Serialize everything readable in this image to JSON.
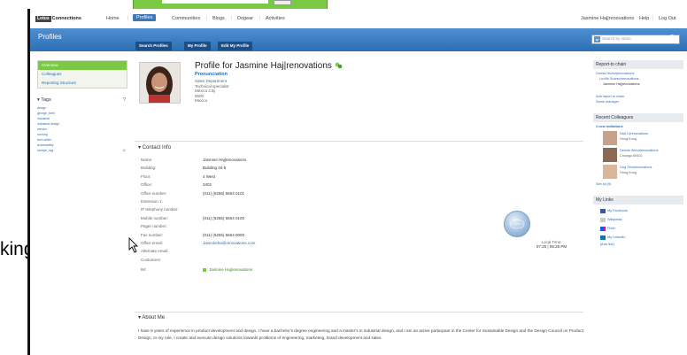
{
  "topnav": {
    "logo_left": "Lotus",
    "logo_right": "Connections",
    "items": [
      "Home",
      "Profiles",
      "Communities",
      "Blogs",
      "Dogear",
      "Activities"
    ],
    "active_index": 1,
    "user": "Jasmine Haj|renovations",
    "help": "Help",
    "logout": "Log Out"
  },
  "header": {
    "title": "Profiles",
    "subtabs": [
      "Search Profiles",
      "My Profile",
      "Edit My Profile"
    ],
    "search_placeholder": "Search by name"
  },
  "leftnav": {
    "items": [
      "Overview",
      "Colleagues",
      "Reporting Structure"
    ],
    "active_index": 0,
    "tags_title": "Tags",
    "tags": [
      "design",
      "george_beth",
      "industrial",
      "industrial design",
      "mentor",
      "running",
      "tech writer",
      "accessibility",
      "sample_tag"
    ],
    "tags_count": "11"
  },
  "profile": {
    "title": "Profile for Jasmine Haj|renovations",
    "pronunciation": "Pronunciation",
    "meta": [
      "Sales Department",
      "Technical specialist",
      "Mexico City",
      "5500",
      "Mexico"
    ]
  },
  "contact": {
    "title": "Contact Info",
    "rows": [
      {
        "label": "Name:",
        "value": "Jasmine Haj|renovations"
      },
      {
        "label": "Building:",
        "value": "Building 34-5"
      },
      {
        "label": "Floor:",
        "value": "4 West"
      },
      {
        "label": "Office:",
        "value": "3402"
      },
      {
        "label": "Office number:",
        "value": "(011) (5255) 5654 0101"
      },
      {
        "label": "Extension 1:",
        "value": ""
      },
      {
        "label": "IP telephony number:",
        "value": ""
      },
      {
        "label": "Mobile number:",
        "value": "(011) (5255) 5654 0100"
      },
      {
        "label": "Pager number:",
        "value": ""
      },
      {
        "label": "Fax number:",
        "value": "(011) (5255) 5654 0000"
      },
      {
        "label": "Office email:",
        "value": "Jasmineha@renovations.com"
      },
      {
        "label": "Alternate email:",
        "value": ""
      },
      {
        "label": "Customers:",
        "value": ""
      },
      {
        "label": "IM:",
        "value": "Jasmine Haj|renovations"
      }
    ],
    "local_time_label": "Local Time:",
    "local_time_value": "07:25 | 05:25 PM"
  },
  "about": {
    "title": "About Me",
    "text": "I have 8 years of experience in product development and design. I have a bachelor's degree engineering and a master's in industrial design, and I am an active participant in the Center for Sustainable Design and the Design Council on Product Design. In my role, I create and execute design solutions towards problems of engineering, marketing, brand development and sales."
  },
  "rightcol": {
    "report_title": "Report-to chain",
    "report_chain": [
      "Donna Nichol|renovations",
      "Lucille Suarez|renovations",
      "Jasmine Haj|renovations"
    ],
    "report_links": [
      "Add report to chain",
      "Same manager"
    ],
    "colleagues_title": "Recent Colleagues",
    "new_invitations": "1 new invitations",
    "colleagues": [
      {
        "name": "Nick Li|renovations",
        "place": "Hong Kong"
      },
      {
        "name": "Dennis Wood|renovations",
        "place": "Chicago 60601"
      },
      {
        "name": "Ling Shin|renovations",
        "place": "Hong Kong"
      }
    ],
    "see_all": "See all (9)",
    "links_title": "My Links",
    "links": [
      "My Facebook",
      "Wikipedia",
      "Flickr",
      "My LinkedIn"
    ],
    "add_link": "[Add link]"
  },
  "outside": {
    "left_text": "king"
  }
}
